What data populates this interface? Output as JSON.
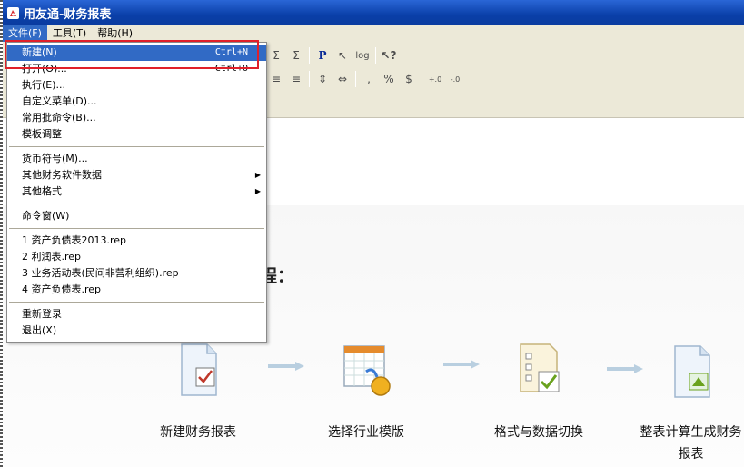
{
  "window": {
    "title": "用友通-财务报表"
  },
  "menubar": [
    {
      "label": "文件(F)",
      "active": true
    },
    {
      "label": "工具(T)",
      "active": false
    },
    {
      "label": "帮助(H)",
      "active": false
    }
  ],
  "file_menu": {
    "items": [
      {
        "label": "新建(N)",
        "shortcut": "Ctrl+N",
        "highlighted": true
      },
      {
        "label": "打开(O)...",
        "shortcut": "Ctrl+O"
      },
      {
        "label": "执行(E)..."
      },
      {
        "label": "自定义菜单(D)..."
      },
      {
        "label": "常用批命令(B)..."
      },
      {
        "label": "模板调整"
      },
      {
        "label": "货币符号(M)..."
      },
      {
        "label": "其他财务软件数据",
        "submenu": true
      },
      {
        "label": "其他格式",
        "submenu": true
      },
      {
        "label": "命令窗(W)"
      },
      {
        "label": "1 资产负债表2013.rep"
      },
      {
        "label": "2 利润表.rep"
      },
      {
        "label": "3 业务活动表(民间非营利组织).rep"
      },
      {
        "label": "4 资产负债表.rep"
      },
      {
        "label": "重新登录"
      },
      {
        "label": "退出(X)"
      }
    ]
  },
  "toolbar": {
    "row1": [
      "Σ",
      "Σ",
      "P",
      "↖",
      "log",
      "↖?"
    ],
    "row2": [
      "≡",
      "≡",
      "⇕",
      "⇔",
      ",",
      "%",
      "$",
      "+.0",
      "-.0"
    ]
  },
  "main": {
    "flow_title": "程：",
    "steps": [
      {
        "label": "新建财务报表"
      },
      {
        "label": "选择行业模版"
      },
      {
        "label": "格式与数据切换"
      },
      {
        "label": "整表计算生成财务报表"
      }
    ]
  },
  "colors": {
    "titlebar": "#0a3fa8",
    "menu_highlight": "#316ac5",
    "callout_border": "#e0202a"
  }
}
